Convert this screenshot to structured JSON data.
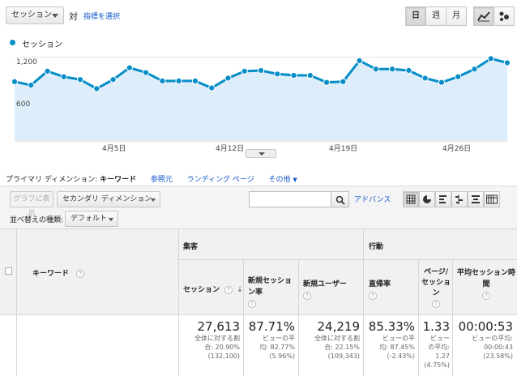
{
  "toolbar": {
    "metric_select": "セッション",
    "vs_label": "対",
    "pick_metric_link": "指標を選択",
    "period_buttons": [
      "日",
      "週",
      "月"
    ],
    "active_period": "日"
  },
  "chart": {
    "legend": "セッション",
    "y_top_label": "1,200",
    "y_mid_label": "600",
    "x_labels": [
      "4月5日",
      "4月12日",
      "4月19日",
      "4月26日"
    ]
  },
  "chart_data": {
    "type": "area",
    "series": [
      {
        "name": "セッション",
        "values": [
          850,
          800,
          1000,
          920,
          880,
          750,
          880,
          1050,
          980,
          860,
          860,
          860,
          760,
          900,
          1000,
          1010,
          960,
          940,
          940,
          840,
          850,
          1150,
          1030,
          1030,
          1010,
          900,
          840,
          920,
          1030,
          1180,
          1120
        ]
      }
    ],
    "ylim": [
      0,
      1300
    ],
    "yticks": [
      600,
      1200
    ],
    "grid": true,
    "color": "#058dc7",
    "fill": "#ddeefa"
  },
  "dimension_bar": {
    "label": "プライマリ ディメンション:",
    "active": "キーワード",
    "links": [
      "参照元",
      "ランディング ページ",
      "その他"
    ]
  },
  "table_toolbar": {
    "plot_rows_button": "グラフに表示",
    "secondary_dimension": "セカンダリ ディメンション",
    "search_placeholder": "",
    "advanced_link": "アドバンス",
    "sort_label": "並べ替えの種類:",
    "sort_value": "デフォルト"
  },
  "table": {
    "keyword_header": "キーワード",
    "group_acquisition": "集客",
    "group_behavior": "行動",
    "help_mark": "?",
    "columns": [
      {
        "label": "セッション",
        "value": "27,613",
        "sub": [
          "全体に対する割",
          "合: 20.90%",
          "(132,100)"
        ]
      },
      {
        "label": "新規セッション率",
        "value": "87.71%",
        "sub": [
          "ビューの平",
          "均: 82.77%",
          "(5.96%)"
        ]
      },
      {
        "label": "新規ユーザー",
        "value": "24,219",
        "sub": [
          "全体に対する割",
          "合: 22.15%",
          "(109,343)"
        ]
      },
      {
        "label": "直帰率",
        "value": "85.33%",
        "sub": [
          "ビューの平",
          "均: 87.45%",
          "(-2.43%)"
        ]
      },
      {
        "label": "ページ/セッション",
        "value": "1.33",
        "sub": [
          "ビュー",
          "の平均:",
          "1.27",
          "(4.75%)"
        ]
      },
      {
        "label": "平均セッション時間",
        "value": "00:00:53",
        "sub": [
          "ビューの平均:",
          "00:00:43",
          "(23.58%)"
        ]
      }
    ]
  }
}
